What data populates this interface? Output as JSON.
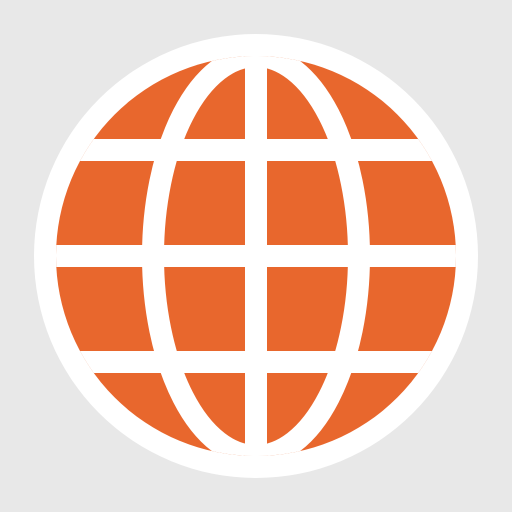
{
  "icon": {
    "name": "globe-icon",
    "colors": {
      "background": "#e8e8e8",
      "badge": "#ffffff",
      "globe_fill": "#e8672d",
      "grid_lines": "#ffffff"
    }
  }
}
